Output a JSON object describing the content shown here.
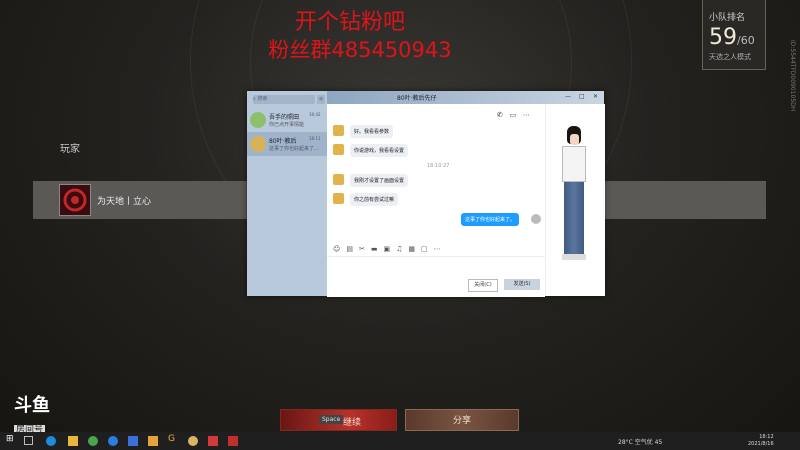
{
  "overlay": {
    "line1": "开个钻粉吧",
    "line2": "粉丝群485450943"
  },
  "rank": {
    "title": "小队排名",
    "current": "59",
    "total": "/60",
    "mode": "天选之人模式"
  },
  "side_id": "ID:5544TFD0090105DH",
  "players": {
    "label": "玩家",
    "name": "为天地丨立心"
  },
  "chat": {
    "title": "80叶·教后先仔",
    "search_placeholder": "搜索",
    "contacts": [
      {
        "name": "吾手的照田",
        "preview": "你已点开事情能",
        "time": "16:42"
      },
      {
        "name": "80叶·教后",
        "preview": "这事了你也好起来了...",
        "time": "18:11"
      }
    ],
    "messages": [
      {
        "text": "好。我看看参数"
      },
      {
        "text": "你说游戏，我看看设置"
      },
      {
        "text": "我刚才设置了画面设置"
      },
      {
        "text": "你之前有尝试过嘛"
      }
    ],
    "timestamp": "18:10:27",
    "my_message": "这事了你也好起来了。",
    "toolbar_icons": [
      "emoji-icon",
      "gif-icon",
      "scissors-icon",
      "folder-icon",
      "image-icon",
      "music-icon",
      "picture-icon",
      "phone-icon",
      "more-icon"
    ],
    "close_btn": "关闭(C)",
    "send_btn": "发送(S)"
  },
  "buttons": {
    "continue_key": "Space",
    "continue": "继续",
    "share": "分享"
  },
  "douyu": {
    "brand": "斗鱼",
    "room_label": "房间号",
    "room_number": "316022"
  },
  "taskbar": {
    "weather": "28°C 空气优 45",
    "time": "18:12",
    "date": "2021/8/16"
  }
}
